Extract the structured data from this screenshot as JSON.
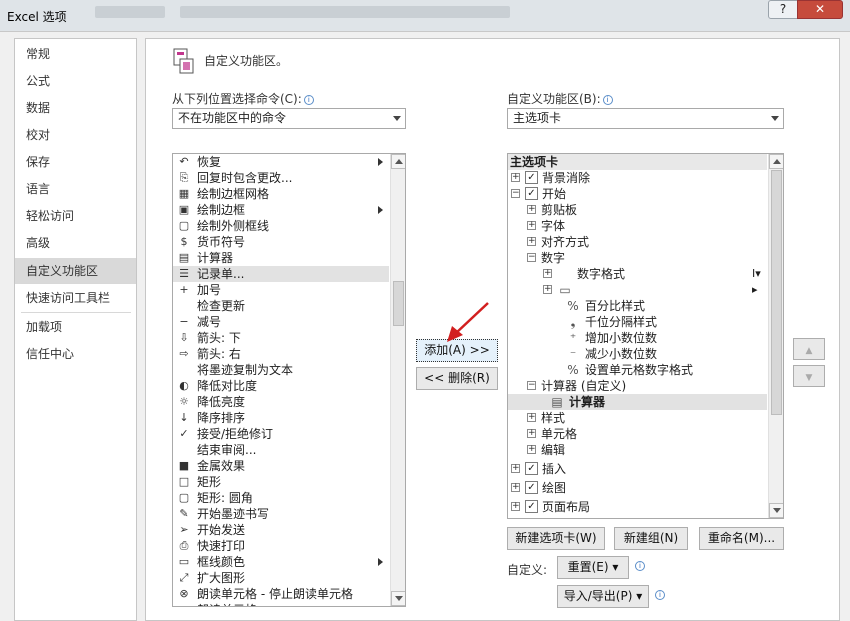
{
  "window": {
    "title": "Excel 选项",
    "help": "?",
    "close": "✕"
  },
  "nav": {
    "items": [
      "常规",
      "公式",
      "数据",
      "校对",
      "保存",
      "语言",
      "轻松访问",
      "高级",
      "自定义功能区",
      "快速访问工具栏",
      "加载项",
      "信任中心"
    ],
    "selected": 8
  },
  "header": {
    "title": "自定义功能区。"
  },
  "left": {
    "label": "从下列位置选择命令(C):",
    "combo": "不在功能区中的命令",
    "items": [
      {
        "icon": "↶",
        "text": "恢复",
        "sub": true
      },
      {
        "icon": "⎘",
        "text": "回复时包含更改..."
      },
      {
        "icon": "▦",
        "text": "绘制边框网格"
      },
      {
        "icon": "▣",
        "text": "绘制边框",
        "sub": true
      },
      {
        "icon": "▢",
        "text": "绘制外侧框线"
      },
      {
        "icon": "$",
        "text": "货币符号"
      },
      {
        "icon": "▤",
        "text": "计算器"
      },
      {
        "icon": "☰",
        "text": "记录单...",
        "selected": true
      },
      {
        "icon": "+",
        "text": "加号"
      },
      {
        "icon": "",
        "text": "检查更新"
      },
      {
        "icon": "−",
        "text": "减号"
      },
      {
        "icon": "⇩",
        "text": "箭头: 下"
      },
      {
        "icon": "⇨",
        "text": "箭头: 右"
      },
      {
        "icon": "",
        "text": "将墨迹复制为文本"
      },
      {
        "icon": "◐",
        "text": "降低对比度"
      },
      {
        "icon": "☼",
        "text": "降低亮度"
      },
      {
        "icon": "↓",
        "text": "降序排序"
      },
      {
        "icon": "✓",
        "text": "接受/拒绝修订"
      },
      {
        "icon": "",
        "text": "结束审阅..."
      },
      {
        "icon": "■",
        "text": "金属效果"
      },
      {
        "icon": "□",
        "text": "矩形"
      },
      {
        "icon": "▢",
        "text": "矩形: 圆角"
      },
      {
        "icon": "✎",
        "text": "开始墨迹书写"
      },
      {
        "icon": "➢",
        "text": "开始发送"
      },
      {
        "icon": "⎙",
        "text": "快速打印"
      },
      {
        "icon": "▭",
        "text": "框线颜色",
        "sub": true
      },
      {
        "icon": "⤢",
        "text": "扩大图形"
      },
      {
        "icon": "⊗",
        "text": "朗读单元格 - 停止朗读单元格"
      },
      {
        "icon": "",
        "text": "朗读单元格"
      }
    ]
  },
  "buttons": {
    "add": "添加(A) >>",
    "remove": "<< 删除(R)"
  },
  "right": {
    "label": "自定义功能区(B):",
    "combo": "主选项卡",
    "header": "主选项卡",
    "nodes": [
      {
        "level": 0,
        "exp": "+",
        "check": true,
        "text": "背景消除"
      },
      {
        "level": 0,
        "exp": "−",
        "check": true,
        "text": "开始"
      },
      {
        "level": 1,
        "exp": "+",
        "text": "剪贴板"
      },
      {
        "level": 1,
        "exp": "+",
        "text": "字体"
      },
      {
        "level": 1,
        "exp": "+",
        "text": "对齐方式"
      },
      {
        "level": 1,
        "exp": "−",
        "text": "数字"
      },
      {
        "level": 2,
        "exp": "+",
        "text": "数字格式",
        "trail": "Ι▾"
      },
      {
        "level": 2,
        "exp": "+",
        "icon": "▭",
        "text": "",
        "trail": "▸"
      },
      {
        "level": 3,
        "icon": "%",
        "text": "百分比样式"
      },
      {
        "level": 3,
        "icon": "❟",
        "text": "千位分隔样式"
      },
      {
        "level": 3,
        "icon": "⁺",
        "text": "增加小数位数"
      },
      {
        "level": 3,
        "icon": "⁻",
        "text": "减少小数位数"
      },
      {
        "level": 3,
        "icon": "%",
        "text": "设置单元格数字格式"
      },
      {
        "level": 1,
        "exp": "−",
        "text": "计算器 (自定义)"
      },
      {
        "level": 2,
        "icon": "▤",
        "text": "计算器",
        "selected": true
      },
      {
        "level": 1,
        "exp": "+",
        "text": "样式"
      },
      {
        "level": 1,
        "exp": "+",
        "text": "单元格"
      },
      {
        "level": 1,
        "exp": "+",
        "text": "编辑"
      },
      {
        "level": 0,
        "exp": "+",
        "check": true,
        "text": "插入"
      },
      {
        "level": 0,
        "exp": "+",
        "check": true,
        "text": "绘图"
      },
      {
        "level": 0,
        "exp": "+",
        "check": true,
        "text": "页面布局"
      }
    ],
    "buttons": {
      "new_tab": "新建选项卡(W)",
      "new_group": "新建组(N)",
      "rename": "重命名(M)..."
    },
    "custom_label": "自定义:",
    "reset": "重置(E) ▾",
    "import_export": "导入/导出(P) ▾"
  }
}
